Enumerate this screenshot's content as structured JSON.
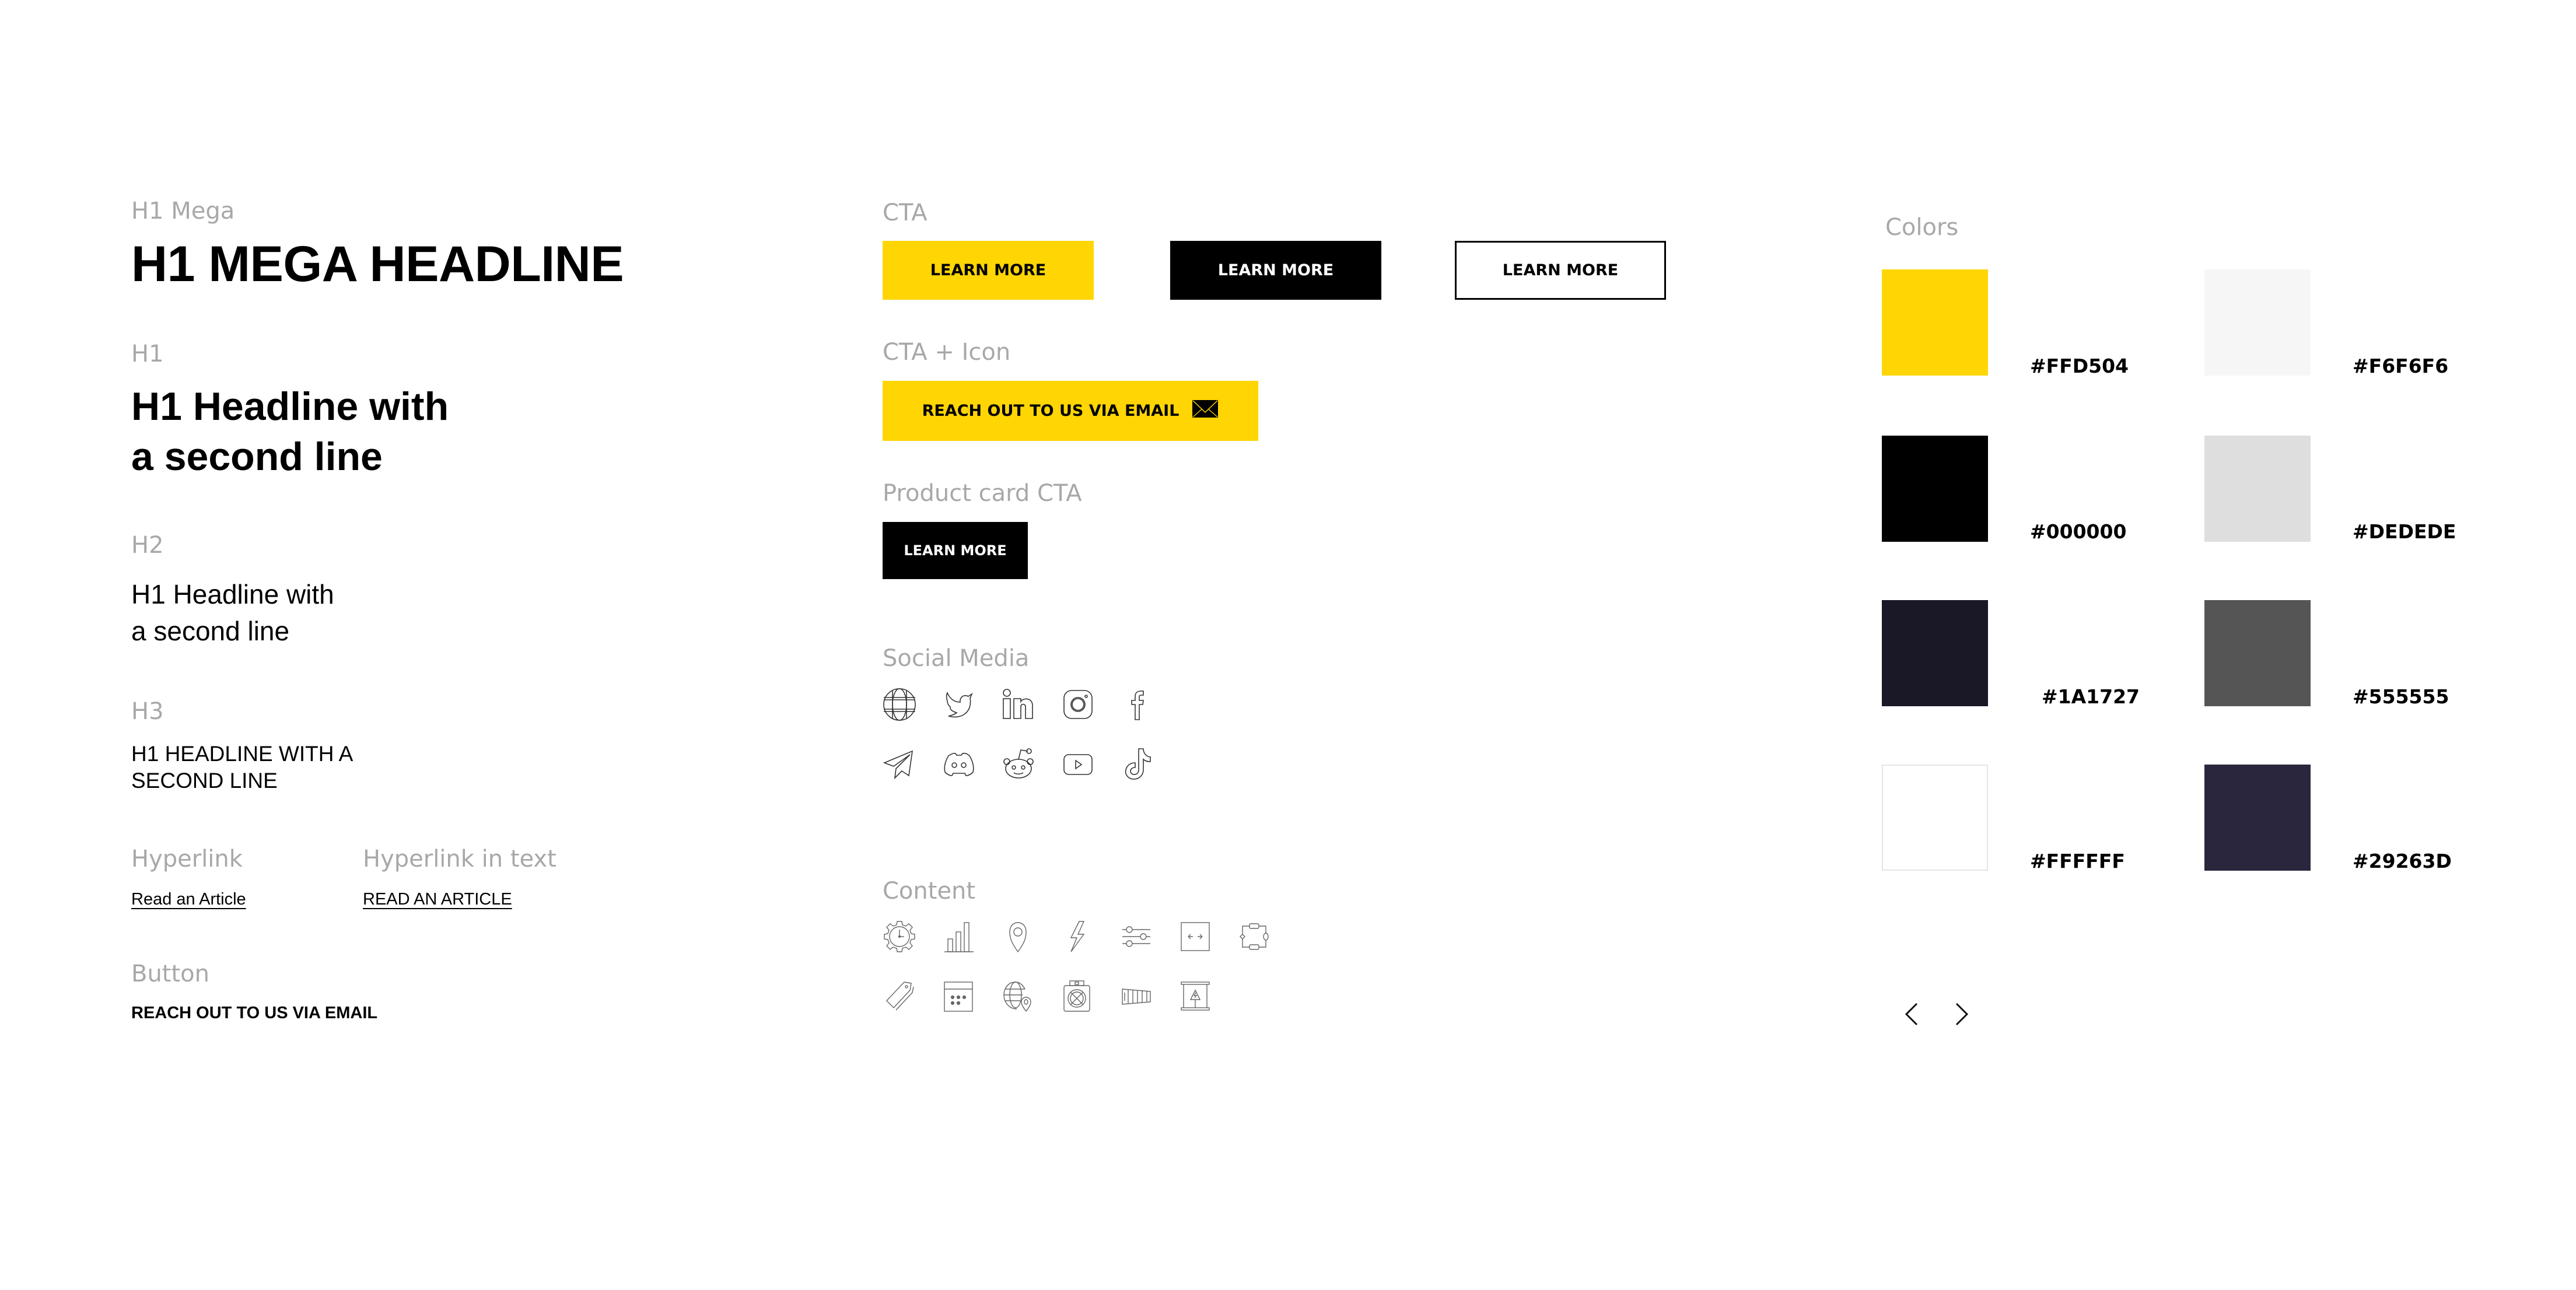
{
  "typography": {
    "h1_mega": {
      "label": "H1 Mega",
      "text": "H1 MEGA HEADLINE"
    },
    "h1": {
      "label": "H1",
      "line1": "H1 Headline with",
      "line2": "a second line"
    },
    "h2": {
      "label": "H2",
      "line1": "H1 Headline with",
      "line2": "a second line"
    },
    "h3": {
      "label": "H3",
      "line1": "H1 HEADLINE WITH A",
      "line2": "SECOND LINE"
    },
    "hyperlink": {
      "label": "Hyperlink",
      "text": "Read an Article"
    },
    "hyperlink_in_text": {
      "label": "Hyperlink in text",
      "text": "READ AN ARTICLE"
    },
    "button": {
      "label": "Button",
      "text": "REACH OUT TO US VIA EMAIL"
    }
  },
  "cta": {
    "label": "CTA",
    "buttons": [
      {
        "style": "yellow",
        "text": "LEARN MORE"
      },
      {
        "style": "black",
        "text": "LEARN MORE"
      },
      {
        "style": "outline",
        "text": "LEARN MORE"
      }
    ]
  },
  "cta_icon": {
    "label": "CTA + Icon",
    "text": "REACH OUT TO US VIA EMAIL",
    "icon": "mail-icon"
  },
  "product_card_cta": {
    "label": "Product card CTA",
    "text": "LEARN MORE"
  },
  "social_media": {
    "label": "Social Media",
    "icons": [
      "globe-icon",
      "twitter-icon",
      "linkedin-icon",
      "instagram-icon",
      "facebook-icon",
      "telegram-icon",
      "discord-icon",
      "reddit-icon",
      "youtube-icon",
      "tiktok-icon"
    ]
  },
  "content": {
    "label": "Content",
    "icons": [
      "gear-clock-icon",
      "bar-chart-icon",
      "location-pin-icon",
      "lightning-icon",
      "sliders-icon",
      "expand-arrows-icon",
      "workflow-icon",
      "tags-icon",
      "calendar-icon",
      "globe-pin-icon",
      "miner-fan-icon",
      "container-icon",
      "power-cabinet-icon"
    ]
  },
  "colors": {
    "label": "Colors",
    "swatches": [
      {
        "hex": "#FFD504"
      },
      {
        "hex": "#F6F6F6"
      },
      {
        "hex": "#000000"
      },
      {
        "hex": "#DEDEDE"
      },
      {
        "hex": "#1A1727"
      },
      {
        "hex": "#555555"
      },
      {
        "hex": "#FFFFFF"
      },
      {
        "hex": "#29263D"
      }
    ]
  },
  "pagination": {
    "prev": "chevron-left-icon",
    "next": "chevron-right-icon"
  }
}
